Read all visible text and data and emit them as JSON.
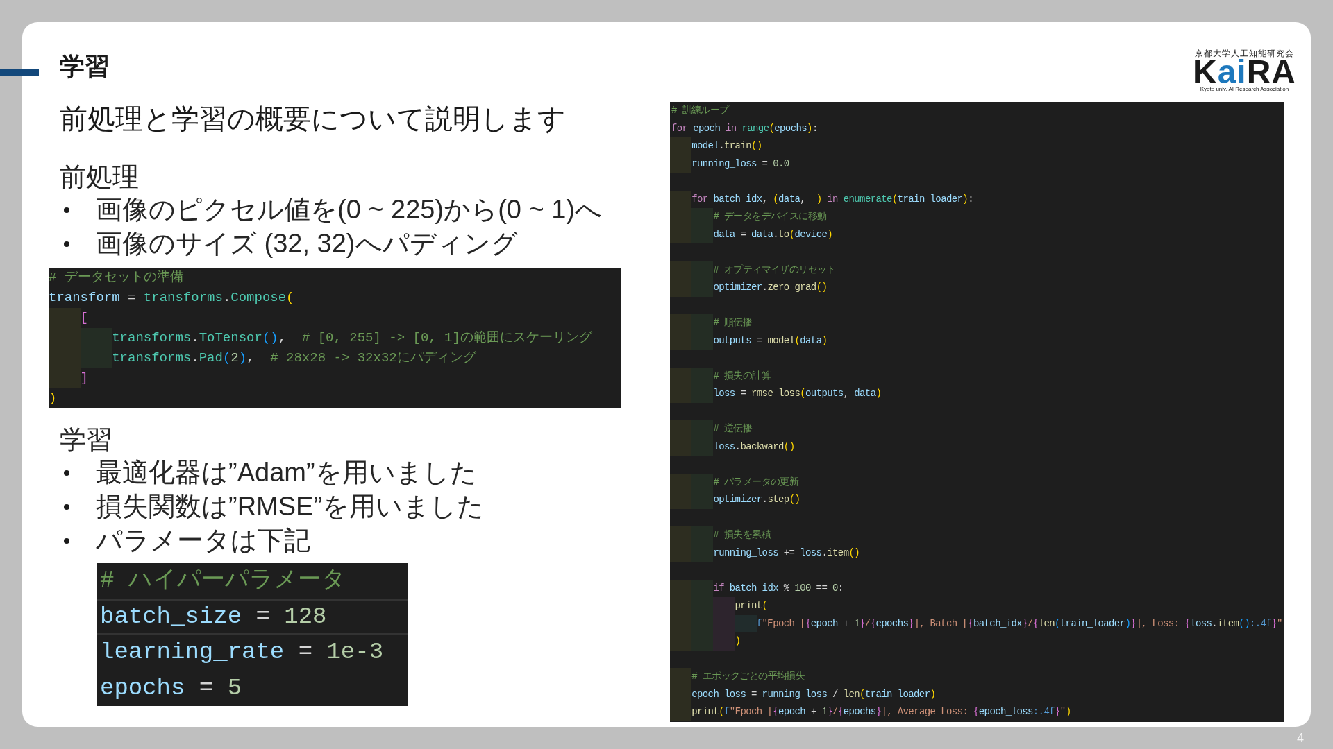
{
  "slide": {
    "title": "学習",
    "subtitle": "前処理と学習の概要について説明します",
    "page_number": "4"
  },
  "logo": {
    "tagline": "京都大学人工知能研究会",
    "wordmark": [
      {
        "text": "K",
        "color": "#1a1a1a"
      },
      {
        "text": "ai",
        "color": "#1d78bd"
      },
      {
        "text": "RA",
        "color": "#1a1a1a"
      }
    ],
    "caption": "Kyoto univ. AI Research Association"
  },
  "sections": [
    {
      "heading": "前処理",
      "bullets": [
        {
          "text": "画像のピクセル値を(0 ~ 225)から(0 ~ 1)へ"
        },
        {
          "text": "画像のサイズ (32, 32)へパディング"
        }
      ],
      "code": {
        "lines": [
          {
            "kind": "code",
            "tokens": [
              {
                "text": "# データセットの準備",
                "kind": "comment"
              }
            ]
          },
          {
            "kind": "code",
            "tokens": [
              {
                "text": "transform",
                "kind": "variable"
              },
              {
                "text": " = ",
                "kind": "plain"
              },
              {
                "text": "transforms",
                "kind": "class"
              },
              {
                "text": ".",
                "kind": "plain"
              },
              {
                "text": "Compose",
                "kind": "class"
              },
              {
                "text": "(",
                "kind": "bracket1"
              }
            ],
            "children": [
              {
                "kind": "code",
                "tokens": [
                  {
                    "text": "[",
                    "kind": "bracket2"
                  }
                ],
                "children": [
                  {
                    "kind": "code",
                    "tokens": [
                      {
                        "text": "transforms",
                        "kind": "class"
                      },
                      {
                        "text": ".",
                        "kind": "plain"
                      },
                      {
                        "text": "ToTensor",
                        "kind": "class"
                      },
                      {
                        "text": "()",
                        "kind": "bracket3"
                      },
                      {
                        "text": ",  ",
                        "kind": "plain"
                      },
                      {
                        "text": "# [0, 255] -> [0, 1]の範囲にスケーリング",
                        "kind": "comment"
                      }
                    ]
                  },
                  {
                    "kind": "code",
                    "tokens": [
                      {
                        "text": "transforms",
                        "kind": "class"
                      },
                      {
                        "text": ".",
                        "kind": "plain"
                      },
                      {
                        "text": "Pad",
                        "kind": "class"
                      },
                      {
                        "text": "(",
                        "kind": "bracket3"
                      },
                      {
                        "text": "2",
                        "kind": "number"
                      },
                      {
                        "text": ")",
                        "kind": "bracket3"
                      },
                      {
                        "text": ",  ",
                        "kind": "plain"
                      },
                      {
                        "text": "# 28x28 -> 32x32にパディング",
                        "kind": "comment"
                      }
                    ]
                  }
                ]
              },
              {
                "kind": "code",
                "tokens": [
                  {
                    "text": "]",
                    "kind": "bracket2"
                  }
                ]
              }
            ]
          },
          {
            "kind": "code",
            "tokens": [
              {
                "text": ")",
                "kind": "bracket1"
              }
            ]
          }
        ]
      }
    },
    {
      "heading": "学習",
      "bullets": [
        {
          "text": "最適化器は”Adam”を用いました"
        },
        {
          "text": "損失関数は”RMSE”を用いました"
        },
        {
          "text": "パラメータは下記",
          "code": {
            "lines": [
              {
                "kind": "code",
                "current": false,
                "tokens": [
                  {
                    "text": "# ハイパーパラメータ",
                    "kind": "comment"
                  }
                ]
              },
              {
                "kind": "code",
                "current": true,
                "tokens": [
                  {
                    "text": "batch_size",
                    "kind": "variable"
                  },
                  {
                    "text": " = ",
                    "kind": "plain"
                  },
                  {
                    "text": "128",
                    "kind": "number"
                  }
                ]
              },
              {
                "kind": "code",
                "current": false,
                "tokens": [
                  {
                    "text": "learning_rate",
                    "kind": "variable"
                  },
                  {
                    "text": " = ",
                    "kind": "plain"
                  },
                  {
                    "text": "1e-3",
                    "kind": "number"
                  }
                ]
              },
              {
                "kind": "code",
                "current": false,
                "tokens": [
                  {
                    "text": "epochs",
                    "kind": "variable"
                  },
                  {
                    "text": " = ",
                    "kind": "plain"
                  },
                  {
                    "text": "5",
                    "kind": "number"
                  }
                ]
              }
            ]
          }
        }
      ]
    }
  ],
  "training_code": {
    "lines": [
      {
        "kind": "code",
        "tokens": [
          {
            "text": "# 訓練ループ",
            "kind": "comment"
          }
        ]
      },
      {
        "kind": "code",
        "tokens": [
          {
            "text": "for ",
            "kind": "keyword"
          },
          {
            "text": "epoch ",
            "kind": "variable"
          },
          {
            "text": "in ",
            "kind": "keyword"
          },
          {
            "text": "range",
            "kind": "class"
          },
          {
            "text": "(",
            "kind": "bracket1"
          },
          {
            "text": "epochs",
            "kind": "variable"
          },
          {
            "text": ")",
            "kind": "bracket1"
          },
          {
            "text": ":",
            "kind": "plain"
          }
        ],
        "children": [
          {
            "kind": "code",
            "tokens": [
              {
                "text": "model",
                "kind": "variable"
              },
              {
                "text": ".",
                "kind": "plain"
              },
              {
                "text": "train",
                "kind": "function"
              },
              {
                "text": "()",
                "kind": "bracket1"
              }
            ]
          },
          {
            "kind": "code",
            "tokens": [
              {
                "text": "running_loss",
                "kind": "variable"
              },
              {
                "text": " = ",
                "kind": "plain"
              },
              {
                "text": "0.0",
                "kind": "number"
              }
            ]
          },
          {
            "kind": "blank"
          },
          {
            "kind": "code",
            "tokens": [
              {
                "text": "for ",
                "kind": "keyword"
              },
              {
                "text": "batch_idx",
                "kind": "variable"
              },
              {
                "text": ", ",
                "kind": "plain"
              },
              {
                "text": "(",
                "kind": "bracket1"
              },
              {
                "text": "data",
                "kind": "variable"
              },
              {
                "text": ", ",
                "kind": "plain"
              },
              {
                "text": "_",
                "kind": "variable"
              },
              {
                "text": ") ",
                "kind": "bracket1"
              },
              {
                "text": "in ",
                "kind": "keyword"
              },
              {
                "text": "enumerate",
                "kind": "class"
              },
              {
                "text": "(",
                "kind": "bracket1"
              },
              {
                "text": "train_loader",
                "kind": "variable"
              },
              {
                "text": ")",
                "kind": "bracket1"
              },
              {
                "text": ":",
                "kind": "plain"
              }
            ],
            "children": [
              {
                "kind": "code",
                "tokens": [
                  {
                    "text": "# データをデバイスに移動",
                    "kind": "comment"
                  }
                ]
              },
              {
                "kind": "code",
                "tokens": [
                  {
                    "text": "data",
                    "kind": "variable"
                  },
                  {
                    "text": " = ",
                    "kind": "plain"
                  },
                  {
                    "text": "data",
                    "kind": "variable"
                  },
                  {
                    "text": ".",
                    "kind": "plain"
                  },
                  {
                    "text": "to",
                    "kind": "function"
                  },
                  {
                    "text": "(",
                    "kind": "bracket1"
                  },
                  {
                    "text": "device",
                    "kind": "variable"
                  },
                  {
                    "text": ")",
                    "kind": "bracket1"
                  }
                ]
              },
              {
                "kind": "blank"
              },
              {
                "kind": "code",
                "tokens": [
                  {
                    "text": "# オプティマイザのリセット",
                    "kind": "comment"
                  }
                ]
              },
              {
                "kind": "code",
                "tokens": [
                  {
                    "text": "optimizer",
                    "kind": "variable"
                  },
                  {
                    "text": ".",
                    "kind": "plain"
                  },
                  {
                    "text": "zero_grad",
                    "kind": "function"
                  },
                  {
                    "text": "()",
                    "kind": "bracket1"
                  }
                ]
              },
              {
                "kind": "blank"
              },
              {
                "kind": "code",
                "tokens": [
                  {
                    "text": "# 順伝播",
                    "kind": "comment"
                  }
                ]
              },
              {
                "kind": "code",
                "tokens": [
                  {
                    "text": "outputs",
                    "kind": "variable"
                  },
                  {
                    "text": " = ",
                    "kind": "plain"
                  },
                  {
                    "text": "model",
                    "kind": "function"
                  },
                  {
                    "text": "(",
                    "kind": "bracket1"
                  },
                  {
                    "text": "data",
                    "kind": "variable"
                  },
                  {
                    "text": ")",
                    "kind": "bracket1"
                  }
                ]
              },
              {
                "kind": "blank"
              },
              {
                "kind": "code",
                "tokens": [
                  {
                    "text": "# 損失の計算",
                    "kind": "comment"
                  }
                ]
              },
              {
                "kind": "code",
                "tokens": [
                  {
                    "text": "loss",
                    "kind": "variable"
                  },
                  {
                    "text": " = ",
                    "kind": "plain"
                  },
                  {
                    "text": "rmse_loss",
                    "kind": "function"
                  },
                  {
                    "text": "(",
                    "kind": "bracket1"
                  },
                  {
                    "text": "outputs",
                    "kind": "variable"
                  },
                  {
                    "text": ", ",
                    "kind": "plain"
                  },
                  {
                    "text": "data",
                    "kind": "variable"
                  },
                  {
                    "text": ")",
                    "kind": "bracket1"
                  }
                ]
              },
              {
                "kind": "blank"
              },
              {
                "kind": "code",
                "tokens": [
                  {
                    "text": "# 逆伝播",
                    "kind": "comment"
                  }
                ]
              },
              {
                "kind": "code",
                "tokens": [
                  {
                    "text": "loss",
                    "kind": "variable"
                  },
                  {
                    "text": ".",
                    "kind": "plain"
                  },
                  {
                    "text": "backward",
                    "kind": "function"
                  },
                  {
                    "text": "()",
                    "kind": "bracket1"
                  }
                ]
              },
              {
                "kind": "blank"
              },
              {
                "kind": "code",
                "tokens": [
                  {
                    "text": "# パラメータの更新",
                    "kind": "comment"
                  }
                ]
              },
              {
                "kind": "code",
                "tokens": [
                  {
                    "text": "optimizer",
                    "kind": "variable"
                  },
                  {
                    "text": ".",
                    "kind": "plain"
                  },
                  {
                    "text": "step",
                    "kind": "function"
                  },
                  {
                    "text": "()",
                    "kind": "bracket1"
                  }
                ]
              },
              {
                "kind": "blank"
              },
              {
                "kind": "code",
                "tokens": [
                  {
                    "text": "# 損失を累積",
                    "kind": "comment"
                  }
                ]
              },
              {
                "kind": "code",
                "tokens": [
                  {
                    "text": "running_loss",
                    "kind": "variable"
                  },
                  {
                    "text": " += ",
                    "kind": "plain"
                  },
                  {
                    "text": "loss",
                    "kind": "variable"
                  },
                  {
                    "text": ".",
                    "kind": "plain"
                  },
                  {
                    "text": "item",
                    "kind": "function"
                  },
                  {
                    "text": "()",
                    "kind": "bracket1"
                  }
                ]
              },
              {
                "kind": "blank"
              },
              {
                "kind": "code",
                "tokens": [
                  {
                    "text": "if ",
                    "kind": "keyword"
                  },
                  {
                    "text": "batch_idx",
                    "kind": "variable"
                  },
                  {
                    "text": " % ",
                    "kind": "plain"
                  },
                  {
                    "text": "100",
                    "kind": "number"
                  },
                  {
                    "text": " == ",
                    "kind": "plain"
                  },
                  {
                    "text": "0",
                    "kind": "number"
                  },
                  {
                    "text": ":",
                    "kind": "plain"
                  }
                ],
                "children": [
                  {
                    "kind": "code",
                    "tokens": [
                      {
                        "text": "print",
                        "kind": "function"
                      },
                      {
                        "text": "(",
                        "kind": "bracket1"
                      }
                    ],
                    "children": [
                      {
                        "kind": "code",
                        "tokens": [
                          {
                            "text": "f",
                            "kind": "storage"
                          },
                          {
                            "text": "\"Epoch [",
                            "kind": "string"
                          },
                          {
                            "text": "{",
                            "kind": "bracket2"
                          },
                          {
                            "text": "epoch",
                            "kind": "variable"
                          },
                          {
                            "text": " + ",
                            "kind": "plain"
                          },
                          {
                            "text": "1",
                            "kind": "number"
                          },
                          {
                            "text": "}",
                            "kind": "bracket2"
                          },
                          {
                            "text": "/",
                            "kind": "string"
                          },
                          {
                            "text": "{",
                            "kind": "bracket2"
                          },
                          {
                            "text": "epochs",
                            "kind": "variable"
                          },
                          {
                            "text": "}",
                            "kind": "bracket2"
                          },
                          {
                            "text": "], Batch [",
                            "kind": "string"
                          },
                          {
                            "text": "{",
                            "kind": "bracket2"
                          },
                          {
                            "text": "batch_idx",
                            "kind": "variable"
                          },
                          {
                            "text": "}",
                            "kind": "bracket2"
                          },
                          {
                            "text": "/",
                            "kind": "string"
                          },
                          {
                            "text": "{",
                            "kind": "bracket2"
                          },
                          {
                            "text": "len",
                            "kind": "function"
                          },
                          {
                            "text": "(",
                            "kind": "bracket3"
                          },
                          {
                            "text": "train_loader",
                            "kind": "variable"
                          },
                          {
                            "text": ")",
                            "kind": "bracket3"
                          },
                          {
                            "text": "}",
                            "kind": "bracket2"
                          },
                          {
                            "text": "], Loss: ",
                            "kind": "string"
                          },
                          {
                            "text": "{",
                            "kind": "bracket2"
                          },
                          {
                            "text": "loss",
                            "kind": "variable"
                          },
                          {
                            "text": ".",
                            "kind": "plain"
                          },
                          {
                            "text": "item",
                            "kind": "function"
                          },
                          {
                            "text": "()",
                            "kind": "bracket3"
                          },
                          {
                            "text": ":.4f",
                            "kind": "storage"
                          },
                          {
                            "text": "}",
                            "kind": "bracket2"
                          },
                          {
                            "text": "\"",
                            "kind": "string"
                          }
                        ]
                      }
                    ]
                  },
                  {
                    "kind": "code",
                    "tokens": [
                      {
                        "text": ")",
                        "kind": "bracket1"
                      }
                    ]
                  }
                ]
              }
            ]
          },
          {
            "kind": "blank"
          },
          {
            "kind": "code",
            "tokens": [
              {
                "text": "# エポックごとの平均損失",
                "kind": "comment"
              }
            ]
          },
          {
            "kind": "code",
            "tokens": [
              {
                "text": "epoch_loss",
                "kind": "variable"
              },
              {
                "text": " = ",
                "kind": "plain"
              },
              {
                "text": "running_loss",
                "kind": "variable"
              },
              {
                "text": " / ",
                "kind": "plain"
              },
              {
                "text": "len",
                "kind": "function"
              },
              {
                "text": "(",
                "kind": "bracket1"
              },
              {
                "text": "train_loader",
                "kind": "variable"
              },
              {
                "text": ")",
                "kind": "bracket1"
              }
            ]
          },
          {
            "kind": "code",
            "tokens": [
              {
                "text": "print",
                "kind": "function"
              },
              {
                "text": "(",
                "kind": "bracket1"
              },
              {
                "text": "f",
                "kind": "storage"
              },
              {
                "text": "\"Epoch [",
                "kind": "string"
              },
              {
                "text": "{",
                "kind": "bracket2"
              },
              {
                "text": "epoch",
                "kind": "variable"
              },
              {
                "text": " + ",
                "kind": "plain"
              },
              {
                "text": "1",
                "kind": "number"
              },
              {
                "text": "}",
                "kind": "bracket2"
              },
              {
                "text": "/",
                "kind": "string"
              },
              {
                "text": "{",
                "kind": "bracket2"
              },
              {
                "text": "epochs",
                "kind": "variable"
              },
              {
                "text": "}",
                "kind": "bracket2"
              },
              {
                "text": "], Average Loss: ",
                "kind": "string"
              },
              {
                "text": "{",
                "kind": "bracket2"
              },
              {
                "text": "epoch_loss",
                "kind": "variable"
              },
              {
                "text": ":.4f",
                "kind": "storage"
              },
              {
                "text": "}",
                "kind": "bracket2"
              },
              {
                "text": "\"",
                "kind": "string"
              },
              {
                "text": ")",
                "kind": "bracket1"
              }
            ]
          }
        ]
      }
    ]
  }
}
